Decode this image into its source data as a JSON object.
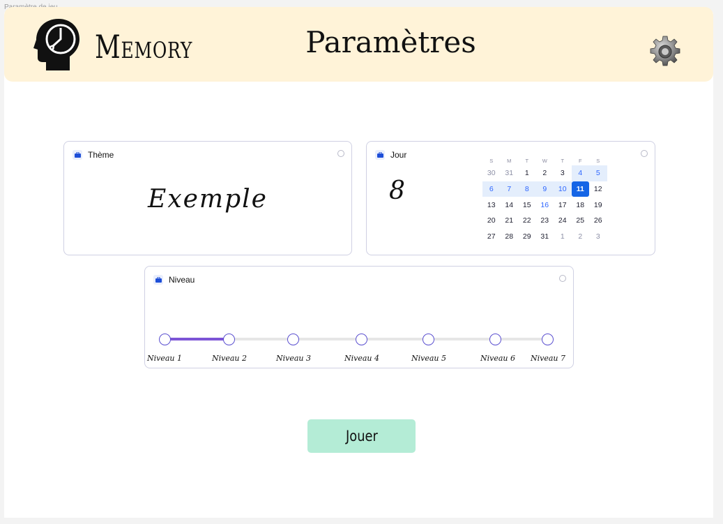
{
  "frame_label": "Paramètre de jeu",
  "header": {
    "logo_text": "Memory",
    "title": "Paramètres",
    "logo_icon": "head-clock-icon",
    "settings_icon": "gear-icon"
  },
  "theme_card": {
    "label": "Thème",
    "value": "Exemple"
  },
  "day_card": {
    "label": "Jour",
    "value": "8",
    "calendar": {
      "weekdays": [
        "S",
        "M",
        "T",
        "W",
        "T",
        "F",
        "S"
      ],
      "weeks": [
        [
          "30",
          "31",
          "1",
          "2",
          "3",
          "4",
          "5"
        ],
        [
          "6",
          "7",
          "8",
          "9",
          "10",
          "11",
          "12"
        ],
        [
          "13",
          "14",
          "15",
          "16",
          "17",
          "18",
          "19"
        ],
        [
          "20",
          "21",
          "22",
          "23",
          "24",
          "25",
          "26"
        ],
        [
          "27",
          "28",
          "29",
          "31",
          "1",
          "2",
          "3"
        ]
      ],
      "selected": "11"
    }
  },
  "level_card": {
    "label": "Niveau",
    "levels": [
      "Niveau 1",
      "Niveau 2",
      "Niveau 3",
      "Niveau 4",
      "Niveau 5",
      "Niveau 6",
      "Niveau 7"
    ],
    "selected_level": 2
  },
  "play_button": {
    "label": "Jouer"
  },
  "colors": {
    "header_bg": "#fff3d8",
    "accent_purple": "#7d55d6",
    "calendar_blue": "#1565e6",
    "play_button_bg": "#b4ecd6"
  }
}
